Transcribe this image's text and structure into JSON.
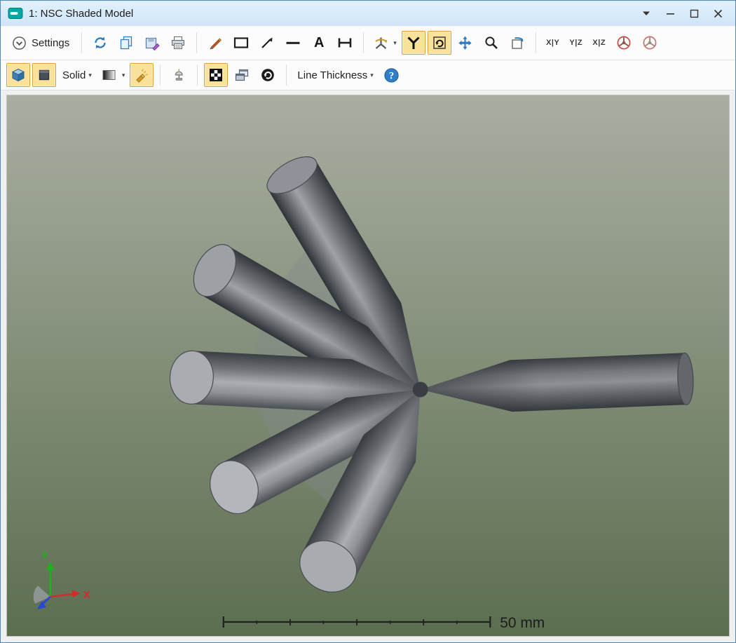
{
  "window": {
    "title": "1: NSC Shaded Model"
  },
  "caret": "▾",
  "toolbar1": {
    "settings_label": "Settings",
    "text_tool_glyph": "A",
    "axis_view_buttons": [
      "X|Y",
      "Y|Z",
      "X|Z"
    ],
    "icons": [
      "settings-chevron-icon",
      "refresh-icon",
      "copy-icon",
      "save-icon",
      "print-icon",
      "pencil-icon",
      "rectangle-icon",
      "arrow-line-icon",
      "horizontal-line-icon",
      "text-icon",
      "dimension-icon",
      "orbit-icon",
      "rotate-free-icon",
      "rotate-z-icon",
      "pan-icon",
      "zoom-icon",
      "rotate-view-icon",
      "rotation-disable-icon-1",
      "rotation-disable-icon-2"
    ]
  },
  "toolbar2": {
    "solid_label": "Solid",
    "line_thickness_label": "Line Thickness",
    "help_glyph": "?",
    "icons": [
      "cube-3d-icon",
      "plane-2d-icon",
      "shading-gradient-icon",
      "flashlight-icon",
      "lamp-icon",
      "background-checker-icon",
      "viewports-icon",
      "animate-icon",
      "help-icon"
    ]
  },
  "viewport": {
    "scale_label": "50 mm",
    "axes": {
      "x": "X",
      "y": "Y"
    },
    "background_top": "#a9aea1",
    "background_bottom": "#5c6e50"
  },
  "colors": {
    "titlebar_bg": "#d8eafa",
    "active_button_bg": "#fbe29b",
    "active_button_border": "#dc9e38",
    "accent_blue": "#2e79c0",
    "app_icon_teal": "#00a9a4"
  }
}
